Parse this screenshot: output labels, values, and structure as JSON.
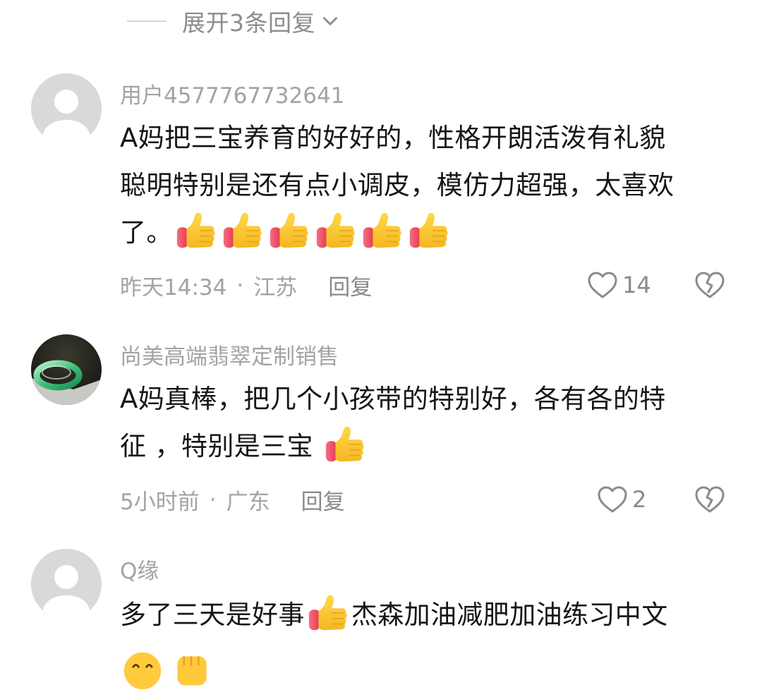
{
  "expand": {
    "label": "展开3条回复"
  },
  "comments": [
    {
      "username": "用户4577767732641",
      "text_lines": [
        "A妈把三宝养育的好好的，性格开朗活泼有礼貌",
        "聪明特别是还有点小调皮，模仿力超强，太喜欢",
        "了。"
      ],
      "emoji_count": 6,
      "time": "昨天14:34",
      "separator": "·",
      "location": "江苏",
      "reply_label": "回复",
      "likes": "14",
      "avatar": "default-avatar"
    },
    {
      "username": "尚美高端翡翠定制销售",
      "text_lines": [
        "A妈真棒，把几个小孩带的特别好，各有各的特",
        "征 ，特别是三宝"
      ],
      "emoji_count": 1,
      "time": "5小时前",
      "separator": "·",
      "location": "广东",
      "reply_label": "回复",
      "likes": "2",
      "avatar": "jade-bangle-avatar"
    },
    {
      "username": "Q缘",
      "text_part1": "多了三天是好事",
      "text_part2": "杰森加油减肥加油练习中文",
      "avatar": "default-avatar"
    }
  ],
  "icons": {
    "like": "heart-outline-icon",
    "dislike": "broken-heart-icon",
    "emoji": "thumbs-up-emoji",
    "expand": "chevron-down-icon"
  },
  "colors": {
    "primary_text": "#161616",
    "secondary_text": "#a3a3a3",
    "icon_gray": "#8a8a8a",
    "thumb_yellow": "#f7c531",
    "sleeve_red": "#f0475a"
  }
}
